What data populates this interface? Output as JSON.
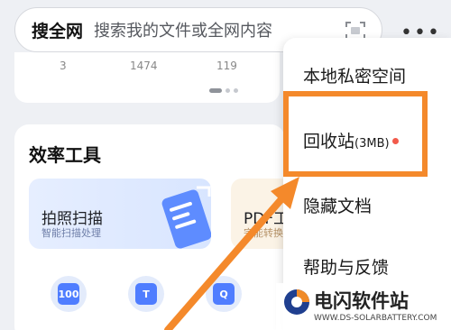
{
  "search": {
    "brand": "搜全网",
    "placeholder": "搜索我的文件或全网内容",
    "icon": "scan-icon"
  },
  "more_menu_icon": "more-icon",
  "stats": [
    "3",
    "1474",
    "119"
  ],
  "tools": {
    "title": "效率工具",
    "scan_card": {
      "title": "拍照扫描",
      "subtitle": "智能扫描处理"
    },
    "pdf_card": {
      "title": "PDF工具",
      "subtitle": "完能转换"
    },
    "icons": [
      {
        "label": "100",
        "icon": "doc-100-icon"
      },
      {
        "label": "T",
        "icon": "text-icon"
      },
      {
        "label": "Q",
        "icon": "search-doc-icon"
      }
    ]
  },
  "menu": {
    "items": [
      {
        "label": "本地私密空间"
      },
      {
        "label": "回收站",
        "size": "(3MB)",
        "badge": "red-dot"
      },
      {
        "label": "隐藏文档"
      },
      {
        "label": "帮助与反馈"
      }
    ]
  },
  "colors": {
    "highlight": "#f4892b",
    "accent": "#4f7dff",
    "badge": "#f25a4b"
  },
  "watermark": {
    "title": "电闪软件站",
    "url": "WWW.DS-SOLARBATTERY.COM"
  }
}
